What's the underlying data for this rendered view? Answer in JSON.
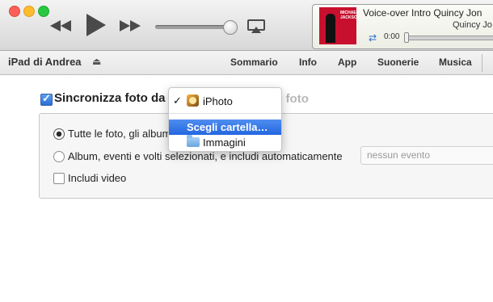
{
  "toolbar": {
    "now_playing": {
      "track": "Voice-over Intro Quincy Jon",
      "artist": "Quincy Jo",
      "time": "0:00",
      "album_art_text": "MICHAEL JACKSON"
    }
  },
  "navbar": {
    "device_name": "iPad di Andrea",
    "tabs": [
      "Sommario",
      "Info",
      "App",
      "Suonerie",
      "Musica"
    ]
  },
  "sync": {
    "label": "Sincronizza foto da",
    "count_text": "1097 foto",
    "options": [
      "Tutte le foto, gli album",
      "Album, eventi e volti selezionati, e includi automaticamente",
      "Includi video"
    ],
    "event_placeholder": "nessun evento"
  },
  "dropdown": {
    "items": [
      "iPhoto",
      "Scegli cartella…",
      "Immagini"
    ],
    "check_mark": "✓"
  }
}
